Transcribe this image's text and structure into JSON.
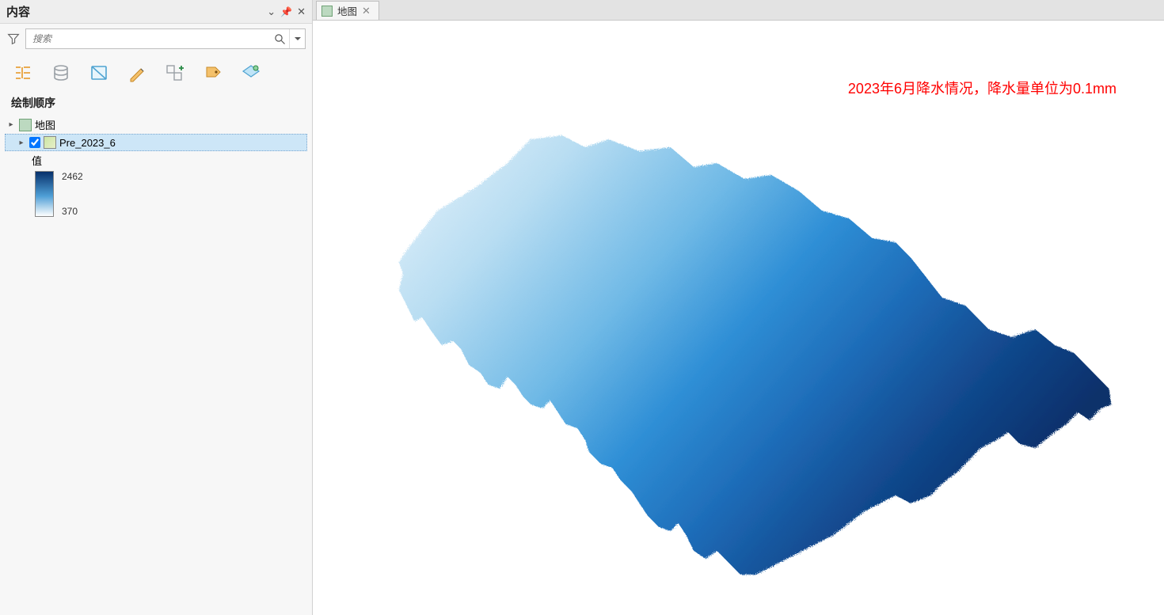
{
  "panel": {
    "title": "内容",
    "search_placeholder": "搜索",
    "section_title": "绘制顺序",
    "map_label": "地图",
    "layer_name": "Pre_2023_6",
    "value_label": "值",
    "ramp_high": "2462",
    "ramp_low": "370"
  },
  "tab": {
    "label": "地图"
  },
  "annotation": "2023年6月降水情况，降水量单位为0.1mm",
  "chart_data": {
    "type": "heatmap",
    "title": "2023年6月降水情况，降水量单位为0.1mm",
    "variable": "Pre_2023_6",
    "value_label": "值",
    "color_ramp": {
      "low_color": "#ffffff",
      "high_color": "#07306b"
    },
    "value_range": {
      "min": 370,
      "max": 2462
    },
    "units": "0.1mm"
  }
}
